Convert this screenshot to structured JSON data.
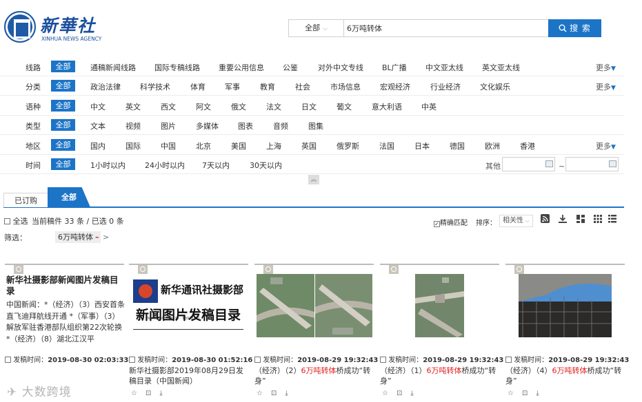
{
  "brand": {
    "name_cn": "新華社",
    "name_en": "XINHUA NEWS AGENCY",
    "color": "#1a4f9c"
  },
  "search": {
    "scope": "全部",
    "query": "6万吨转体",
    "button": "搜 索"
  },
  "accent": "#1c74c7",
  "filters": [
    {
      "label": "线路",
      "all": "全部",
      "options": [
        "通稿新闻线路",
        "国际专稿线路",
        "重要公用信息",
        "公鉴",
        "对外中文专线",
        "BL广播",
        "中文亚太线",
        "英文亚太线"
      ],
      "more": "更多"
    },
    {
      "label": "分类",
      "all": "全部",
      "options": [
        "政治法律",
        "科学技术",
        "体育",
        "军事",
        "教育",
        "社会",
        "市场信息",
        "宏观经济",
        "行业经济",
        "文化娱乐"
      ],
      "more": "更多"
    },
    {
      "label": "语种",
      "all": "全部",
      "options": [
        "中文",
        "英文",
        "西文",
        "阿文",
        "俄文",
        "法文",
        "日文",
        "葡文",
        "意大利语",
        "中英"
      ]
    },
    {
      "label": "类型",
      "all": "全部",
      "options": [
        "文本",
        "视频",
        "图片",
        "多媒体",
        "图表",
        "音频",
        "图集"
      ]
    },
    {
      "label": "地区",
      "all": "全部",
      "options": [
        "国内",
        "国际",
        "中国",
        "北京",
        "美国",
        "上海",
        "英国",
        "俄罗斯",
        "法国",
        "日本",
        "德国",
        "欧洲",
        "香港"
      ],
      "more": "更多"
    },
    {
      "label": "时间",
      "all": "全部",
      "options": [
        "1小时以内",
        "24小时以内",
        "7天以内",
        "30天以内"
      ]
    }
  ],
  "time_other": "其他",
  "tabs": [
    "已订购",
    "全部"
  ],
  "toolbar": {
    "select_all": "全选",
    "count": "当前稿件 33 条 / 已选 0 条",
    "exact_match": "精确匹配",
    "sort_label": "排序：",
    "sort_value": "相关性"
  },
  "filter_bar": {
    "label": "筛选：",
    "chip": "6万吨转体",
    "chip_remove": "–",
    "arrow": ">"
  },
  "cards": [
    {
      "title": "新华社摄影部新闻图片发稿目录",
      "abstract": "中国新闻：*（经济）（3）西安首条直飞迪拜航线开通 *（军事）（3）解放军驻香港部队组织第22次轮换 *（经济）（8）湖北江汉平",
      "time_label": "发稿时间：",
      "time": "2019-08-30 02:03:33"
    },
    {
      "thumb_text": "新华通讯社摄影部",
      "thumb_text2": "新闻图片发稿目录",
      "time_label": "发稿时间：",
      "time": "2019-08-30 01:52:16",
      "caption": "新华社摄影部2019年08月29日发稿目录（中国新闻）"
    },
    {
      "time_label": "发稿时间：",
      "time": "2019-08-29 19:32:43",
      "cap_pre": "（经济）（2）",
      "cap_hl": "6万吨转体",
      "cap_post": "桥成功“转身”"
    },
    {
      "time_label": "发稿时间：",
      "time": "2019-08-29 19:32:43",
      "cap_pre": "（经济）（1）",
      "cap_hl": "6万吨转体",
      "cap_post": "桥成功“转身”"
    },
    {
      "time_label": "发稿时间：",
      "time": "2019-08-29 19:32:43",
      "cap_pre": "（经济）（4）",
      "cap_hl": "6万吨转体",
      "cap_post": "桥成功“转身”"
    }
  ],
  "watermark": "大数跨境"
}
